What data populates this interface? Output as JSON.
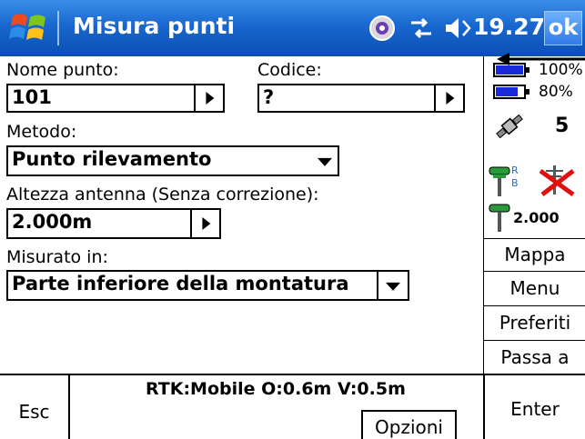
{
  "titlebar": {
    "title": "Misura punti",
    "clock": "19.27",
    "ok_label": "ok",
    "icons": [
      "windows-start-icon",
      "sync-icon",
      "connectivity-icon",
      "volume-icon"
    ]
  },
  "form": {
    "nome_punto_label": "Nome punto:",
    "nome_punto_value": "101",
    "codice_label": "Codice:",
    "codice_value": "?",
    "metodo_label": "Metodo:",
    "metodo_value": "Punto rilevamento",
    "altezza_label": "Altezza antenna (Senza correzione):",
    "altezza_value": "2.000m",
    "misurato_label": "Misurato in:",
    "misurato_value": "Parte inferiore della montatura"
  },
  "status_panel": {
    "battery1_pct": "100%",
    "battery1_level": 1.0,
    "battery2_pct": "80%",
    "battery2_level": 0.8,
    "satellites": "5",
    "rover_height": "2.000",
    "rover_tag": "R",
    "base_tag": "B"
  },
  "side_buttons": [
    "Mappa",
    "Menu",
    "Preferiti",
    "Passa a"
  ],
  "bottombar": {
    "esc_label": "Esc",
    "rtk_status": "RTK:Mobile O:0.6m V:0.5m",
    "opzioni_label": "Opzioni",
    "enter_label": "Enter"
  },
  "colors": {
    "titlebar": "#1867cf",
    "battery_fill": "#1a2adb",
    "no_radio_x": "#e01010"
  }
}
